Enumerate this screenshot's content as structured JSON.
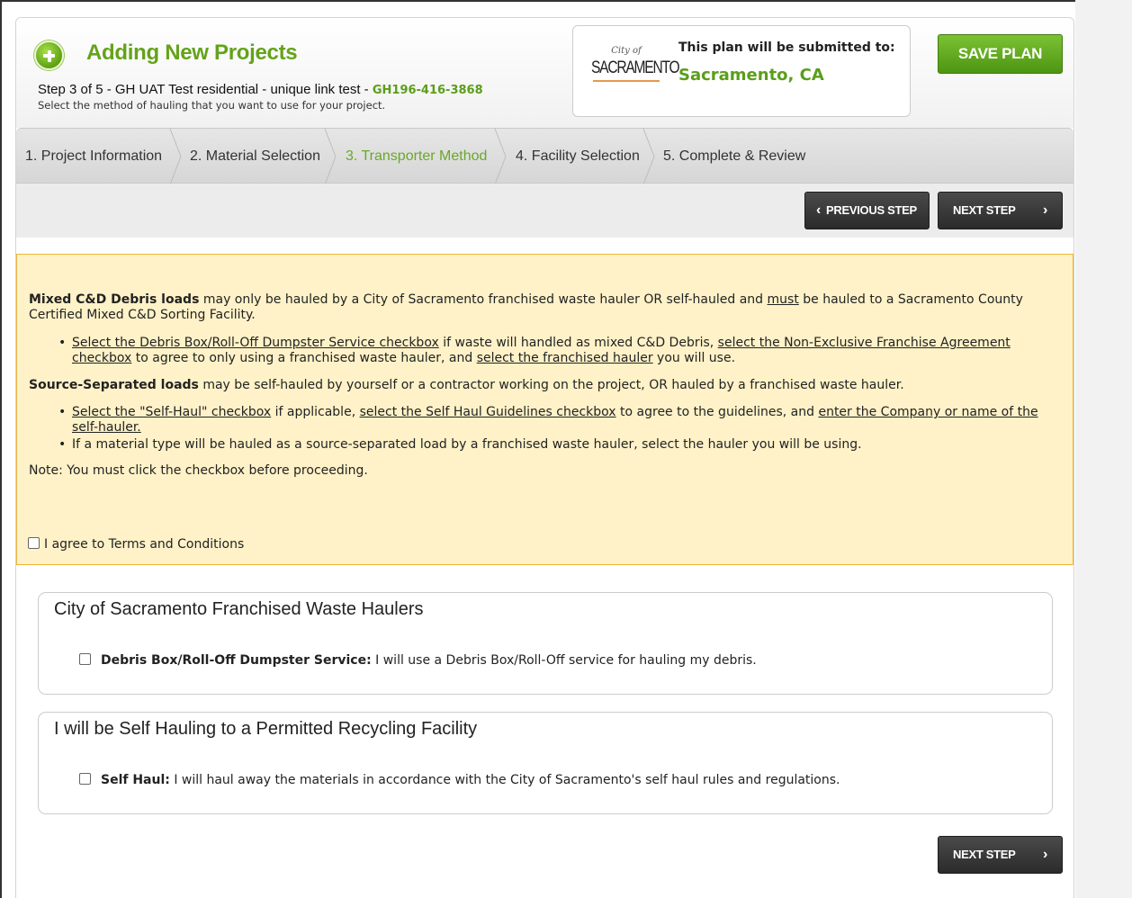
{
  "header": {
    "title": "Adding New Projects",
    "step_text": "Step 3 of 5 - GH UAT Test residential - unique link test - ",
    "project_id": "GH196-416-3868",
    "subtitle": "Select the method of hauling that you want to use for your project.",
    "submit_label": "This plan will be submitted to:",
    "submit_city": "Sacramento, CA",
    "logo_text_small": "City of",
    "logo_text_main": "SACRAMENTO",
    "save_label": "SAVE PLAN"
  },
  "tabs": [
    {
      "label": "1. Project Information"
    },
    {
      "label": "2. Material Selection"
    },
    {
      "label": "3. Transporter Method"
    },
    {
      "label": "4. Facility Selection"
    },
    {
      "label": "5. Complete & Review"
    }
  ],
  "nav": {
    "previous_label": "PREVIOUS STEP",
    "next_label": "NEXT STEP",
    "prev_icon": "‹",
    "next_icon": "›"
  },
  "notice": {
    "p1_bold": "Mixed C&D Debris loads",
    "p1_a": " may only be hauled by a City of Sacramento franchised waste hauler OR self-hauled and ",
    "p1_must": "must",
    "p1_b": " be hauled to a Sacramento County Certified Mixed C&D Sorting Facility.",
    "b1_link1": "Select the Debris Box/Roll-Off Dumpster Service checkbox",
    "b1_t1": " if waste will handled as mixed C&D Debris, ",
    "b1_link2": "select the Non-Exclusive Franchise Agreement checkbox",
    "b1_t2": " to agree to only using a franchised waste hauler, and ",
    "b1_link3": "select the franchised hauler",
    "b1_t3": " you will use.",
    "p2_bold": "Source-Separated loads",
    "p2_text": " may be self-hauled by yourself or a contractor working on the project, OR hauled by a franchised waste hauler.",
    "b2_link1": "Select the \"Self-Haul\" checkbox",
    "b2_t1": " if applicable, ",
    "b2_link2": "select the Self Haul Guidelines checkbox",
    "b2_t2": " to agree to the guidelines, and ",
    "b2_link3": "enter the Company or name of the self-hauler.",
    "b3_text": "If a material type will be hauled as a source-separated load by a franchised waste hauler, select the hauler you will be using.",
    "note": "Note: You must click the checkbox before proceeding.",
    "agree_label": "I agree to Terms and Conditions"
  },
  "sections": [
    {
      "title": "City of Sacramento Franchised Waste Haulers",
      "option_bold": "Debris Box/Roll-Off Dumpster Service:",
      "option_text": " I will use a Debris Box/Roll-Off service for hauling my debris."
    },
    {
      "title": "I will be Self Hauling to a Permitted Recycling Facility",
      "option_bold": "Self Haul:",
      "option_text": " I will haul away the materials in accordance with the City of Sacramento's self haul rules and regulations."
    }
  ],
  "colors": {
    "accent_green": "#5a9e1a",
    "notice_bg": "#fff2c8",
    "notice_border": "#f0b33a",
    "dark_button": "#2b2b2b"
  }
}
